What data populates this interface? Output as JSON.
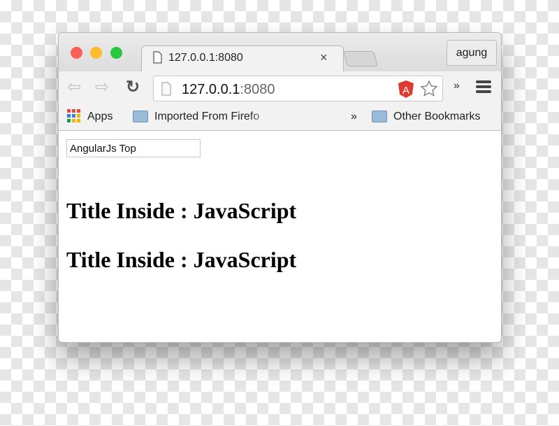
{
  "browser": {
    "tab_title": "127.0.0.1:8080",
    "profile": "agung",
    "url_host": "127.0.0.1",
    "url_port": ":8080",
    "bookmarks": {
      "apps": "Apps",
      "imported": "Imported From Firefo",
      "overflow": "»",
      "other": "Other Bookmarks"
    },
    "colors": {
      "close": "#fc5f57",
      "minimize": "#fdbc2e",
      "maximize": "#28c840",
      "angular": "#dd3b30"
    }
  },
  "page": {
    "input_value": "AngularJs Top",
    "headings": [
      "Title Inside : JavaScript",
      "Title Inside : JavaScript"
    ]
  }
}
